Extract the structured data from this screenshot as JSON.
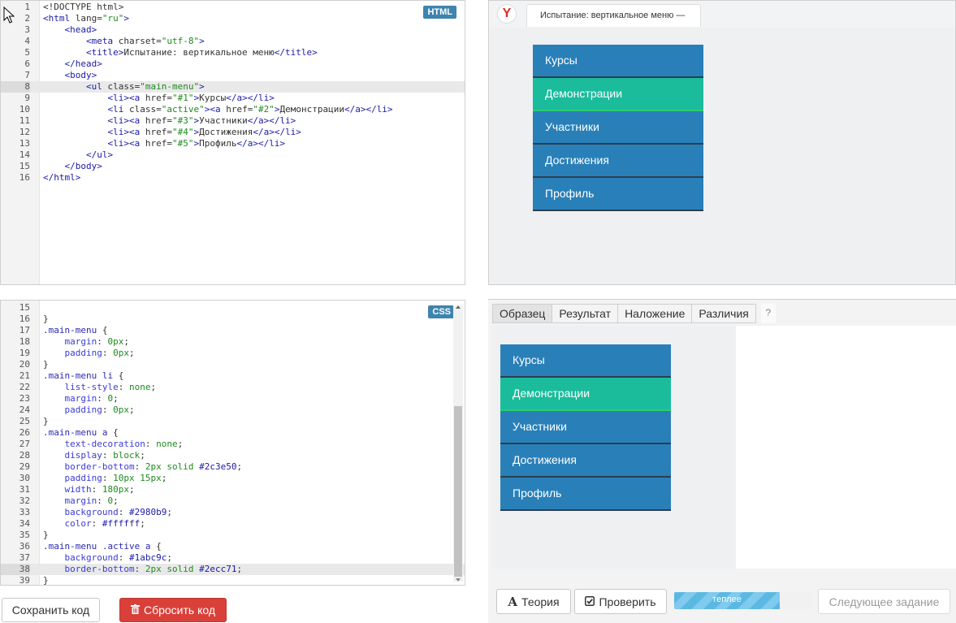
{
  "html_editor": {
    "badge": "HTML",
    "current_line": 8,
    "lines": [
      {
        "n": "1",
        "parts": [
          [
            "t-doc",
            "<!DOCTYPE html>"
          ]
        ]
      },
      {
        "n": "2",
        "parts": [
          [
            "t-tag",
            "<html "
          ],
          [
            "t-attr",
            "lang="
          ],
          [
            "t-str",
            "\"ru\""
          ],
          [
            "t-tag",
            ">"
          ]
        ]
      },
      {
        "n": "3",
        "parts": [
          [
            "",
            "    "
          ],
          [
            "t-tag",
            "<head>"
          ]
        ]
      },
      {
        "n": "4",
        "parts": [
          [
            "",
            "        "
          ],
          [
            "t-tag",
            "<meta "
          ],
          [
            "t-attr",
            "charset="
          ],
          [
            "t-str",
            "\"utf-8\""
          ],
          [
            "t-tag",
            ">"
          ]
        ]
      },
      {
        "n": "5",
        "parts": [
          [
            "",
            "        "
          ],
          [
            "t-tag",
            "<title>"
          ],
          [
            "",
            "Испытание: вертикальное меню"
          ],
          [
            "t-tag",
            "</title>"
          ]
        ]
      },
      {
        "n": "6",
        "parts": [
          [
            "",
            "    "
          ],
          [
            "t-tag",
            "</head>"
          ]
        ]
      },
      {
        "n": "7",
        "parts": [
          [
            "",
            "    "
          ],
          [
            "t-tag",
            "<body>"
          ]
        ]
      },
      {
        "n": "8",
        "parts": [
          [
            "",
            "        "
          ],
          [
            "t-tag",
            "<ul "
          ],
          [
            "t-attr",
            "class="
          ],
          [
            "t-str",
            "\"main-menu\""
          ],
          [
            "t-tag",
            ">"
          ]
        ]
      },
      {
        "n": "9",
        "parts": [
          [
            "",
            "            "
          ],
          [
            "t-tag",
            "<li><a "
          ],
          [
            "t-attr",
            "href="
          ],
          [
            "t-str",
            "\"#1\""
          ],
          [
            "t-tag",
            ">"
          ],
          [
            "",
            "Курсы"
          ],
          [
            "t-tag",
            "</a></li>"
          ]
        ]
      },
      {
        "n": "10",
        "parts": [
          [
            "",
            "            "
          ],
          [
            "t-tag",
            "<li "
          ],
          [
            "t-attr",
            "class="
          ],
          [
            "t-str",
            "\"active\""
          ],
          [
            "t-tag",
            "><a "
          ],
          [
            "t-attr",
            "href="
          ],
          [
            "t-str",
            "\"#2\""
          ],
          [
            "t-tag",
            ">"
          ],
          [
            "",
            "Демонстрации"
          ],
          [
            "t-tag",
            "</a></li>"
          ]
        ]
      },
      {
        "n": "11",
        "parts": [
          [
            "",
            "            "
          ],
          [
            "t-tag",
            "<li><a "
          ],
          [
            "t-attr",
            "href="
          ],
          [
            "t-str",
            "\"#3\""
          ],
          [
            "t-tag",
            ">"
          ],
          [
            "",
            "Участники"
          ],
          [
            "t-tag",
            "</a></li>"
          ]
        ]
      },
      {
        "n": "12",
        "parts": [
          [
            "",
            "            "
          ],
          [
            "t-tag",
            "<li><a "
          ],
          [
            "t-attr",
            "href="
          ],
          [
            "t-str",
            "\"#4\""
          ],
          [
            "t-tag",
            ">"
          ],
          [
            "",
            "Достижения"
          ],
          [
            "t-tag",
            "</a></li>"
          ]
        ]
      },
      {
        "n": "13",
        "parts": [
          [
            "",
            "            "
          ],
          [
            "t-tag",
            "<li><a "
          ],
          [
            "t-attr",
            "href="
          ],
          [
            "t-str",
            "\"#5\""
          ],
          [
            "t-tag",
            ">"
          ],
          [
            "",
            "Профиль"
          ],
          [
            "t-tag",
            "</a></li>"
          ]
        ]
      },
      {
        "n": "14",
        "parts": [
          [
            "",
            "        "
          ],
          [
            "t-tag",
            "</ul>"
          ]
        ]
      },
      {
        "n": "15",
        "parts": [
          [
            "",
            "    "
          ],
          [
            "t-tag",
            "</body>"
          ]
        ]
      },
      {
        "n": "16",
        "parts": [
          [
            "t-tag",
            "</html>"
          ]
        ]
      }
    ]
  },
  "css_editor": {
    "badge": "CSS",
    "current_line": 38,
    "lines": [
      {
        "n": "15",
        "parts": [
          [
            "",
            ""
          ]
        ]
      },
      {
        "n": "16",
        "parts": [
          [
            "",
            "}"
          ]
        ]
      },
      {
        "n": "17",
        "parts": [
          [
            "t-sel",
            ".main-menu"
          ],
          [
            "",
            " {"
          ]
        ]
      },
      {
        "n": "18",
        "parts": [
          [
            "",
            "    "
          ],
          [
            "t-prop",
            "margin"
          ],
          [
            "",
            ": "
          ],
          [
            "t-num",
            "0px"
          ],
          [
            "",
            ";"
          ]
        ]
      },
      {
        "n": "19",
        "parts": [
          [
            "",
            "    "
          ],
          [
            "t-prop",
            "padding"
          ],
          [
            "",
            ": "
          ],
          [
            "t-num",
            "0px"
          ],
          [
            "",
            ";"
          ]
        ]
      },
      {
        "n": "20",
        "parts": [
          [
            "",
            "}"
          ]
        ]
      },
      {
        "n": "21",
        "parts": [
          [
            "t-sel",
            ".main-menu li"
          ],
          [
            "",
            " {"
          ]
        ]
      },
      {
        "n": "22",
        "parts": [
          [
            "",
            "    "
          ],
          [
            "t-prop",
            "list-style"
          ],
          [
            "",
            ": "
          ],
          [
            "t-val",
            "none"
          ],
          [
            "",
            ";"
          ]
        ]
      },
      {
        "n": "23",
        "parts": [
          [
            "",
            "    "
          ],
          [
            "t-prop",
            "margin"
          ],
          [
            "",
            ": "
          ],
          [
            "t-num",
            "0"
          ],
          [
            "",
            ";"
          ]
        ]
      },
      {
        "n": "24",
        "parts": [
          [
            "",
            "    "
          ],
          [
            "t-prop",
            "padding"
          ],
          [
            "",
            ": "
          ],
          [
            "t-num",
            "0px"
          ],
          [
            "",
            ";"
          ]
        ]
      },
      {
        "n": "25",
        "parts": [
          [
            "",
            "}"
          ]
        ]
      },
      {
        "n": "26",
        "parts": [
          [
            "t-sel",
            ".main-menu a"
          ],
          [
            "",
            " {"
          ]
        ]
      },
      {
        "n": "27",
        "parts": [
          [
            "",
            "    "
          ],
          [
            "t-prop",
            "text-decoration"
          ],
          [
            "",
            ": "
          ],
          [
            "t-val",
            "none"
          ],
          [
            "",
            ";"
          ]
        ]
      },
      {
        "n": "28",
        "parts": [
          [
            "",
            "    "
          ],
          [
            "t-prop",
            "display"
          ],
          [
            "",
            ": "
          ],
          [
            "t-val",
            "block"
          ],
          [
            "",
            ";"
          ]
        ]
      },
      {
        "n": "29",
        "parts": [
          [
            "",
            "    "
          ],
          [
            "t-prop",
            "border-bottom"
          ],
          [
            "",
            ": "
          ],
          [
            "t-num",
            "2px"
          ],
          [
            "",
            " "
          ],
          [
            "t-val",
            "solid"
          ],
          [
            "",
            " "
          ],
          [
            "t-hex",
            "#2c3e50"
          ],
          [
            "",
            ";"
          ]
        ]
      },
      {
        "n": "30",
        "parts": [
          [
            "",
            "    "
          ],
          [
            "t-prop",
            "padding"
          ],
          [
            "",
            ": "
          ],
          [
            "t-num",
            "10px 15px"
          ],
          [
            "",
            ";"
          ]
        ]
      },
      {
        "n": "31",
        "parts": [
          [
            "",
            "    "
          ],
          [
            "t-prop",
            "width"
          ],
          [
            "",
            ": "
          ],
          [
            "t-num",
            "180px"
          ],
          [
            "",
            ";"
          ]
        ]
      },
      {
        "n": "32",
        "parts": [
          [
            "",
            "    "
          ],
          [
            "t-prop",
            "margin"
          ],
          [
            "",
            ": "
          ],
          [
            "t-num",
            "0"
          ],
          [
            "",
            ";"
          ]
        ]
      },
      {
        "n": "33",
        "parts": [
          [
            "",
            "    "
          ],
          [
            "t-prop",
            "background"
          ],
          [
            "",
            ": "
          ],
          [
            "t-hex",
            "#2980b9"
          ],
          [
            "",
            ";"
          ]
        ]
      },
      {
        "n": "34",
        "parts": [
          [
            "",
            "    "
          ],
          [
            "t-prop",
            "color"
          ],
          [
            "",
            ": "
          ],
          [
            "t-hex",
            "#ffffff"
          ],
          [
            "",
            ";"
          ]
        ]
      },
      {
        "n": "35",
        "parts": [
          [
            "",
            "}"
          ]
        ]
      },
      {
        "n": "36",
        "parts": [
          [
            "t-sel",
            ".main-menu .active a"
          ],
          [
            "",
            " {"
          ]
        ]
      },
      {
        "n": "37",
        "parts": [
          [
            "",
            "    "
          ],
          [
            "t-prop",
            "background"
          ],
          [
            "",
            ": "
          ],
          [
            "t-hex",
            "#1abc9c"
          ],
          [
            "",
            ";"
          ]
        ]
      },
      {
        "n": "38",
        "parts": [
          [
            "",
            "    "
          ],
          [
            "t-prop",
            "border-bottom"
          ],
          [
            "",
            ": "
          ],
          [
            "t-num",
            "2px"
          ],
          [
            "",
            " "
          ],
          [
            "t-val",
            "solid"
          ],
          [
            "",
            " "
          ],
          [
            "t-hex",
            "#2ecc71"
          ],
          [
            "",
            ";"
          ]
        ]
      },
      {
        "n": "39",
        "parts": [
          [
            "",
            "}"
          ]
        ]
      }
    ]
  },
  "buttons": {
    "save": "Сохранить код",
    "reset": "Сбросить код",
    "theory": "Теория",
    "check": "Проверить",
    "next": "Следующее задание"
  },
  "browser": {
    "logo": "Y",
    "tab_title": "Испытание: вертикальное меню —"
  },
  "menu_items": [
    "Курсы",
    "Демонстрации",
    "Участники",
    "Достижения",
    "Профиль"
  ],
  "active_index": 1,
  "colors": {
    "menu_bg": "#2980b9",
    "menu_border": "#2c3e50",
    "active_bg": "#1abc9c",
    "active_border": "#2ecc71",
    "reset_button": "#d9403a",
    "html_badge": "#3f84ad"
  },
  "compare": {
    "tabs": [
      "Образец",
      "Результат",
      "Наложение",
      "Различия"
    ],
    "help": "?",
    "progress_label": "теплее",
    "progress_fraction": 0.77
  },
  "icons": {
    "reset": "trash-icon",
    "theory": "theory-a-icon",
    "check": "check-square-icon",
    "cursor": "mouse-pointer-icon"
  }
}
